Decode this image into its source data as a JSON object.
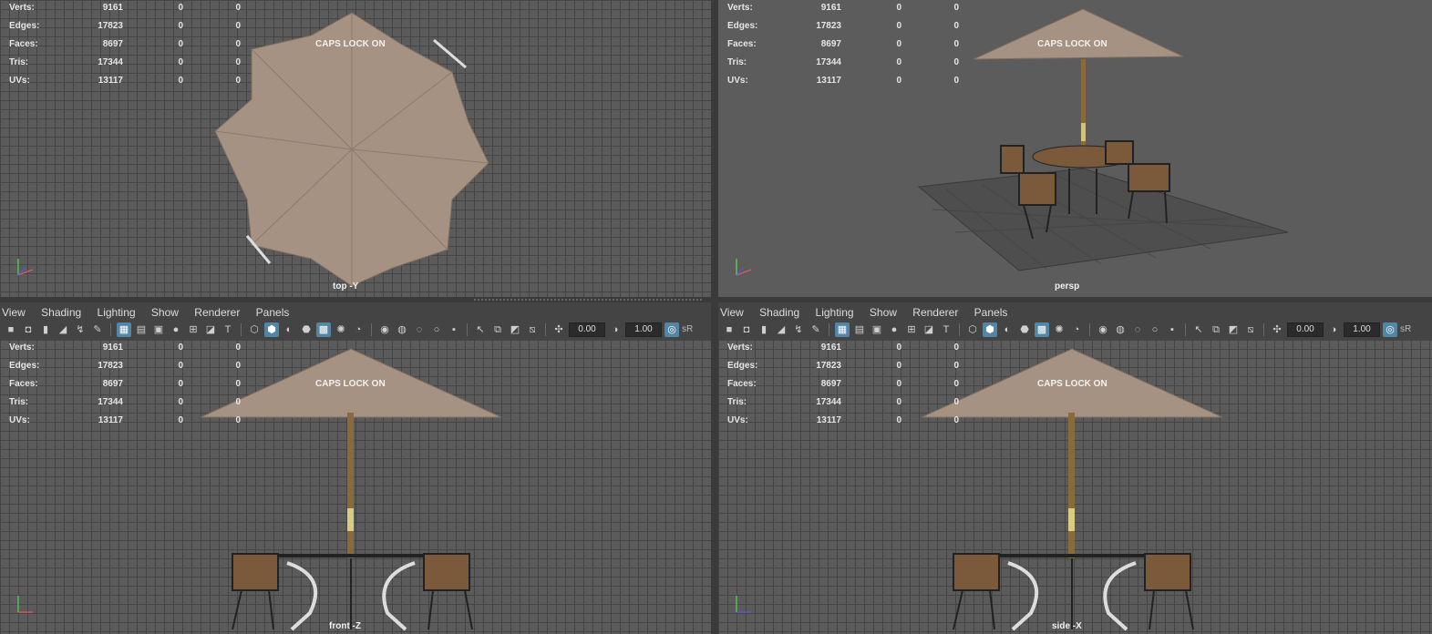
{
  "stats": {
    "rows": [
      {
        "label": "Verts:",
        "v1": "9161",
        "v2": "0",
        "v3": "0"
      },
      {
        "label": "Edges:",
        "v1": "17823",
        "v2": "0",
        "v3": "0"
      },
      {
        "label": "Faces:",
        "v1": "8697",
        "v2": "0",
        "v3": "0"
      },
      {
        "label": "Tris:",
        "v1": "17344",
        "v2": "0",
        "v3": "0"
      },
      {
        "label": "UVs:",
        "v1": "13117",
        "v2": "0",
        "v3": "0"
      }
    ]
  },
  "caps_lock": "CAPS LOCK ON",
  "cameras": {
    "top": "top -Y",
    "persp": "persp",
    "front": "front -Z",
    "side": "side -X"
  },
  "menu": {
    "view": "View",
    "shading": "Shading",
    "lighting": "Lighting",
    "show": "Show",
    "renderer": "Renderer",
    "panels": "Panels"
  },
  "toolbar": {
    "exposure": "0.00",
    "gamma": "1.00",
    "srgb": "sR"
  },
  "icons": [
    "camera-icon",
    "camera-attributes-icon",
    "bookmark-icon",
    "image-plane-icon",
    "2d-pan-zoom-icon",
    "grease-pencil-icon",
    "grid-icon",
    "film-gate-icon",
    "resolution-gate-icon",
    "gate-mask-icon",
    "field-chart-icon",
    "safe-action-icon",
    "safe-title-icon",
    "wireframe-icon",
    "smooth-shade-icon",
    "default-material-icon",
    "wireframe-on-shaded-icon",
    "xray-icon",
    "use-lights-icon",
    "shadows-icon",
    "screen-space-ao-icon",
    "motion-blur-icon",
    "antialiasing-icon",
    "depth-of-field-icon",
    "isolate-select-icon",
    "xray-joints-icon",
    "xray-active-icon",
    "textured-icon",
    "hud-icon"
  ],
  "colors": {
    "viewport_bg": "#5b5b5b",
    "grid_line": "#454545",
    "canopy": "#a69282",
    "pole": "#8a6a3a",
    "toolbar_active": "#5285a6"
  }
}
